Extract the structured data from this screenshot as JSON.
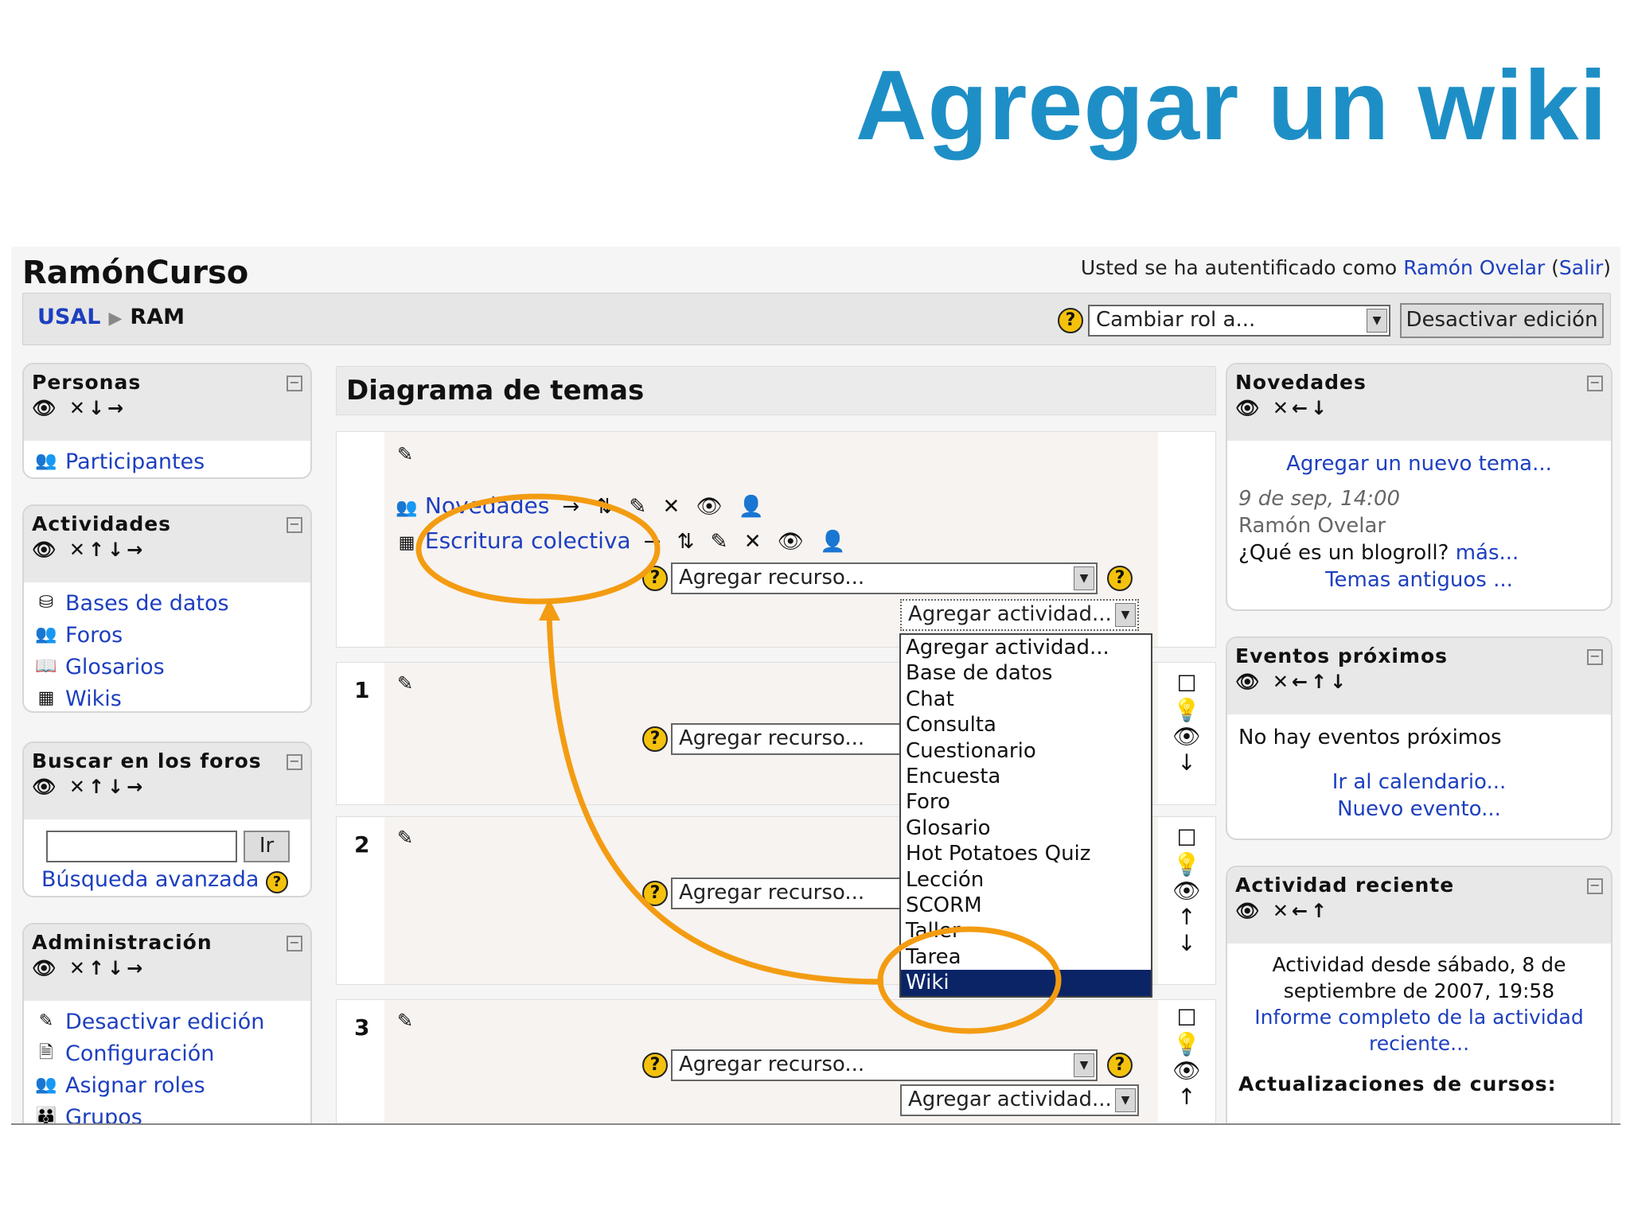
{
  "slide_title": "Agregar un wiki",
  "site": {
    "name": "RamónCurso",
    "login_prefix": "Usted se ha autentificado como ",
    "user": "Ramón Ovelar",
    "logout": "Salir"
  },
  "breadcrumb": {
    "home": "USAL",
    "current": "RAM"
  },
  "nav": {
    "role_select": "Cambiar rol a...",
    "edit_button": "Desactivar edición",
    "help": "?"
  },
  "blocks_left": {
    "personas": {
      "title": "Personas",
      "controls": "✕↓→",
      "items": [
        {
          "label": "Participantes",
          "icon": "people-icon"
        }
      ]
    },
    "actividades": {
      "title": "Actividades",
      "controls": "✕↑↓→",
      "items": [
        {
          "label": "Bases de datos",
          "icon": "database-icon"
        },
        {
          "label": "Foros",
          "icon": "forum-icon"
        },
        {
          "label": "Glosarios",
          "icon": "glossary-icon"
        },
        {
          "label": "Wikis",
          "icon": "wiki-icon"
        }
      ]
    },
    "buscar": {
      "title": "Buscar en los foros",
      "controls": "✕↑↓→",
      "go": "Ir",
      "advanced": "Búsqueda avanzada"
    },
    "admin": {
      "title": "Administración",
      "controls": "✕↑↓→",
      "items": [
        {
          "label": "Desactivar edición",
          "icon": "edit-icon"
        },
        {
          "label": "Configuración",
          "icon": "settings-icon"
        },
        {
          "label": "Asignar roles",
          "icon": "roles-icon"
        },
        {
          "label": "Grupos",
          "icon": "groups-icon"
        }
      ]
    }
  },
  "main": {
    "title": "Diagrama de temas",
    "resources": [
      {
        "label": "Novedades",
        "controls": "→ ⇅ ✎ ✕ 👁 👤"
      },
      {
        "label": "Escritura colectiva",
        "controls": "→ ⇅ ✎ ✕ 👁 👤"
      }
    ],
    "add_resource": "Agregar recurso...",
    "add_activity": "Agregar actividad...",
    "topic_numbers": [
      "1",
      "2",
      "3"
    ],
    "activity_menu": [
      "Agregar actividad...",
      "Base de datos",
      "Chat",
      "Consulta",
      "Cuestionario",
      "Encuesta",
      "Foro",
      "Glosario",
      "Hot Potatoes Quiz",
      "Lección",
      "SCORM",
      "Taller",
      "Tarea",
      "Wiki"
    ],
    "selected_activity": "Wiki"
  },
  "blocks_right": {
    "novedades": {
      "title": "Novedades",
      "controls": "✕←↓",
      "add": "Agregar un nuevo tema...",
      "date": "9 de sep, 14:00",
      "author": "Ramón Ovelar",
      "post": "¿Qué es un blogroll? ",
      "more": "más...",
      "older": "Temas antiguos ..."
    },
    "eventos": {
      "title": "Eventos próximos",
      "controls": "✕←↑↓",
      "none": "No hay eventos próximos",
      "calendar": "Ir al calendario...",
      "new_event": "Nuevo evento..."
    },
    "actividad": {
      "title": "Actividad reciente",
      "controls": "✕←↑",
      "since": "Actividad desde sábado, 8 de septiembre de 2007, 19:58",
      "report": "Informe completo de la actividad reciente...",
      "updates": "Actualizaciones de cursos:"
    }
  },
  "colors": {
    "title": "#1e8fc6",
    "annotation": "#f39c12",
    "link": "#1d3fbf",
    "selection": "#0a2466"
  }
}
